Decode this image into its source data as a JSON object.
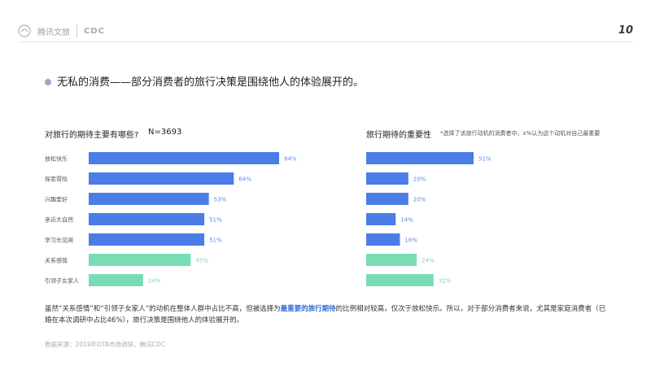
{
  "header": {
    "logo_text": "腾讯文旅",
    "partner_logo": "CDC",
    "page_number": "10"
  },
  "headline": "无私的消费——部分消费者的旅行决策是围绕他人的体验展开的。",
  "left_chart_header": {
    "title": "对旅行的期待主要有哪些?",
    "n_label": "N=3693"
  },
  "right_chart_header": {
    "title": "旅行期待的重要性",
    "note": "*选择了该旅行动机的消费者中，x%认为这个动机对自己最重要"
  },
  "colors": {
    "blue": "#4a7de6",
    "green": "#78ddb5",
    "label": "#555555",
    "value_blue": "#5b8cf0",
    "value_green": "#7fd6b3"
  },
  "chart_data": [
    {
      "type": "bar",
      "orientation": "horizontal",
      "title": "对旅行的期待主要有哪些?",
      "categories": [
        "放松快乐",
        "探索冒险",
        "兴趣爱好",
        "亲近大自然",
        "学习长见闻",
        "关系感情",
        "引领子女家人"
      ],
      "values": [
        84,
        64,
        53,
        51,
        51,
        45,
        24
      ],
      "value_labels": [
        "84%",
        "64%",
        "53%",
        "51%",
        "51%",
        "45%",
        "24%"
      ],
      "bar_colors": [
        "blue",
        "blue",
        "blue",
        "blue",
        "blue",
        "green",
        "green"
      ],
      "unit": "%",
      "xlim": [
        0,
        100
      ]
    },
    {
      "type": "bar",
      "orientation": "horizontal",
      "title": "旅行期待的重要性",
      "categories": [
        "放松快乐",
        "探索冒险",
        "兴趣爱好",
        "亲近大自然",
        "学习长见闻",
        "关系感情",
        "引领子女家人"
      ],
      "values": [
        51,
        20,
        20,
        14,
        16,
        24,
        32
      ],
      "value_labels": [
        "51%",
        "20%",
        "20%",
        "14%",
        "16%",
        "24%",
        "32%"
      ],
      "bar_colors": [
        "blue",
        "blue",
        "blue",
        "blue",
        "blue",
        "green",
        "green"
      ],
      "unit": "%",
      "xlim": [
        0,
        60
      ]
    }
  ],
  "body": {
    "part1": "虽然“关系感情”和“引领子女家人”的动机在整体人群中占比不高，但被选择为",
    "highlight": "最重要的旅行期待",
    "part2": "的比例相对较高，仅次于放松快乐。所以，对于部分消费者来说，尤其是家庭消费者（已婚在本次调研中占比46%），旅行决策是围绕他人的体验展开的。"
  },
  "source": "数据来源：2019年OTA市场调研，腾讯CDC"
}
